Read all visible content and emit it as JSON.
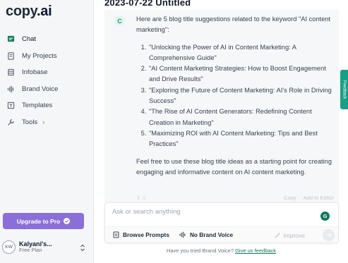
{
  "app": {
    "logo_text": "copy",
    "logo_dot": ".ai",
    "accent_color": "#8b6fd8",
    "brand_green": "#0f7a5c"
  },
  "sidebar": {
    "items": [
      {
        "label": "Chat",
        "icon": "chat-icon"
      },
      {
        "label": "My Projects",
        "icon": "projects-icon"
      },
      {
        "label": "Infobase",
        "icon": "database-icon"
      },
      {
        "label": "Brand Voice",
        "icon": "voice-bars-icon"
      },
      {
        "label": "Templates",
        "icon": "template-icon"
      },
      {
        "label": "Tools",
        "icon": "wrench-icon"
      }
    ],
    "upgrade_label": "Upgrade to Pro",
    "user": {
      "initials": "KW",
      "name": "Kalyani's...",
      "plan": "Free Plan"
    }
  },
  "document": {
    "title": "2023-07-22 Untitled"
  },
  "message": {
    "avatar_letter": "C",
    "intro": "Here are 5 blog title suggestions related to the keyword \"AI content marketing\":",
    "titles": [
      "\"Unlocking the Power of AI in Content Marketing: A Comprehensive Guide\"",
      "\"AI Content Marketing Strategies: How to Boost Engagement and Drive Results\"",
      "\"Exploring the Future of Content Marketing: AI's Role in Driving Success\"",
      "\"The Rise of AI Content Generators: Redefining Content Creation in Marketing\"",
      "\"Maximizing ROI with AI Content Marketing: Tips and Best Practices\""
    ],
    "outro": "Feel free to use these blog title ideas as a starting point for creating engaging and informative content on AI content marketing.",
    "actions": {
      "copy": "Copy",
      "add_to_editor": "Add to Editor"
    }
  },
  "composer": {
    "placeholder": "Ask or search anything",
    "badge_letter": "G",
    "browse_prompts": "Browse Prompts",
    "brand_voice": "No Brand Voice",
    "improve": "Improve"
  },
  "footer": {
    "text": "Have you tried Brand Voice?",
    "link": "Give us feedback"
  },
  "side_tab": {
    "label": "Feedback"
  }
}
